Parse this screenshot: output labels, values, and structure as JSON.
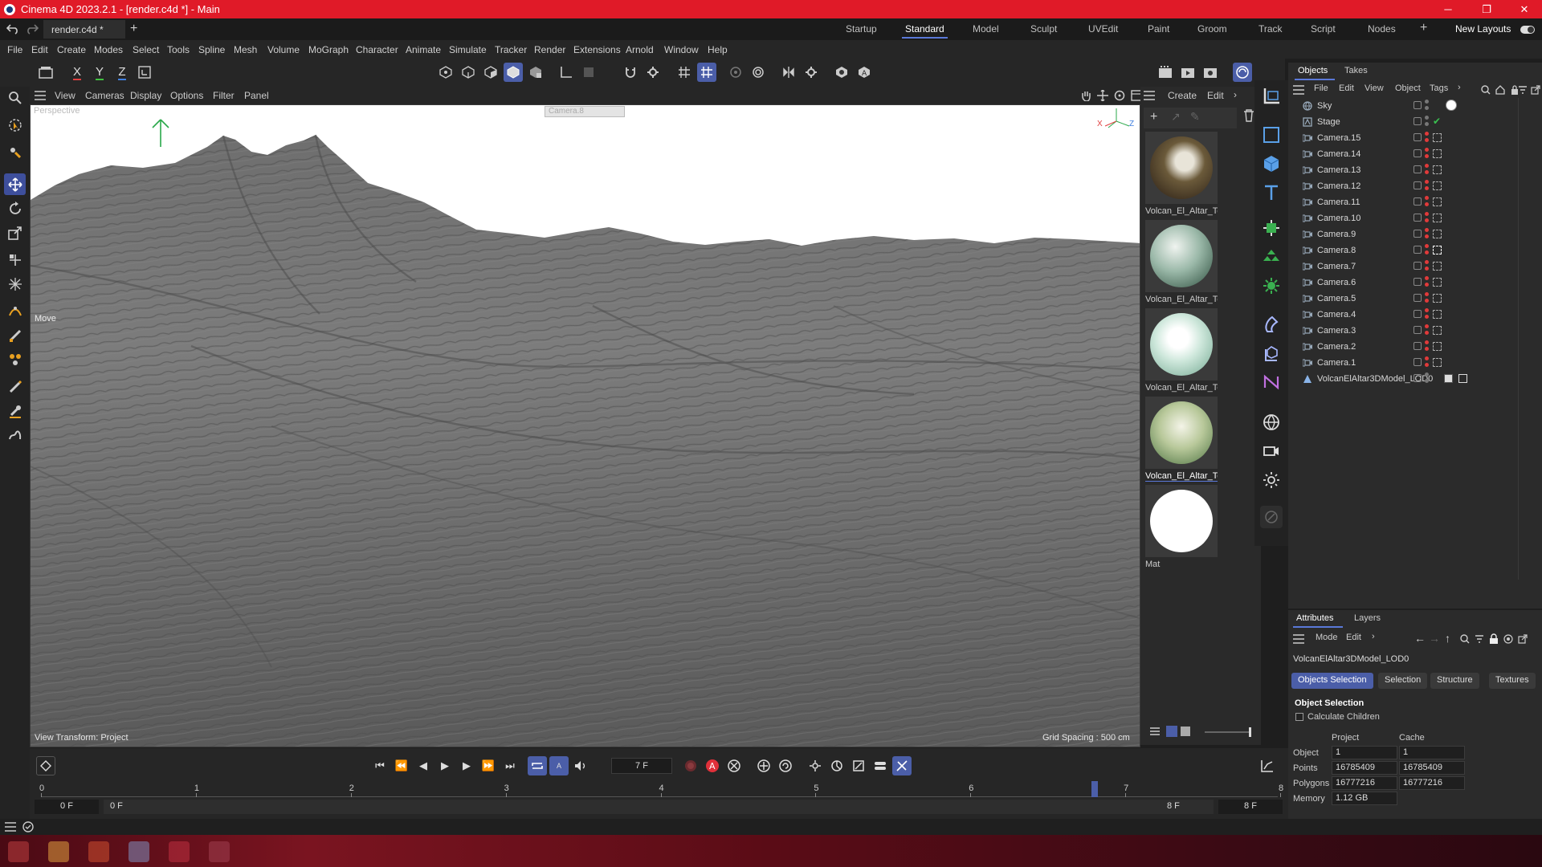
{
  "window": {
    "title": "Cinema 4D 2023.2.1 - [render.c4d *] - Main",
    "controls": [
      "─",
      "❐",
      "✕"
    ]
  },
  "tabs": {
    "document": "render.c4d *",
    "add": "+"
  },
  "layouts": {
    "items": [
      "Startup",
      "Standard",
      "Model",
      "Sculpt",
      "UVEdit",
      "Paint",
      "Groom",
      "Track",
      "Script",
      "Nodes"
    ],
    "active": "Standard",
    "add": "+",
    "new_layouts": "New Layouts"
  },
  "menu": [
    "File",
    "Edit",
    "Create",
    "Modes",
    "Select",
    "Tools",
    "Spline",
    "Mesh",
    "Volume",
    "MoGraph",
    "Character",
    "Animate",
    "Simulate",
    "Tracker",
    "Render",
    "Extensions",
    "Arnold",
    "Window",
    "Help"
  ],
  "toolbar": {
    "x": "X",
    "y": "Y",
    "z": "Z"
  },
  "viewport": {
    "menu": [
      "View",
      "Cameras",
      "Display",
      "Options",
      "Filter",
      "Panel"
    ],
    "label": "Perspective",
    "camera": "Camera.8",
    "tool": "Move",
    "view_transform": "View Transform: Project",
    "grid_spacing": "Grid Spacing : 500 cm",
    "axis_x": "X",
    "axis_z": "Z"
  },
  "materials": {
    "menu": [
      "Create",
      "Edit"
    ],
    "items": [
      {
        "name": "Volcan_El_Altar_Te"
      },
      {
        "name": "Volcan_El_Altar_Te"
      },
      {
        "name": "Volcan_El_Altar_Te"
      },
      {
        "name": "Volcan_El_Altar_Te"
      },
      {
        "name": "Mat"
      }
    ]
  },
  "objects": {
    "tabs": [
      "Objects",
      "Takes"
    ],
    "menu": [
      "File",
      "Edit",
      "View",
      "Object",
      "Tags"
    ],
    "items": [
      {
        "name": "Sky"
      },
      {
        "name": "Stage"
      },
      {
        "name": "Camera.15"
      },
      {
        "name": "Camera.14"
      },
      {
        "name": "Camera.13"
      },
      {
        "name": "Camera.12"
      },
      {
        "name": "Camera.11"
      },
      {
        "name": "Camera.10"
      },
      {
        "name": "Camera.9"
      },
      {
        "name": "Camera.8"
      },
      {
        "name": "Camera.7"
      },
      {
        "name": "Camera.6"
      },
      {
        "name": "Camera.5"
      },
      {
        "name": "Camera.4"
      },
      {
        "name": "Camera.3"
      },
      {
        "name": "Camera.2"
      },
      {
        "name": "Camera.1"
      },
      {
        "name": "VolcanElAltar3DModel_LOD0"
      }
    ]
  },
  "attributes": {
    "tabs": [
      "Attributes",
      "Layers"
    ],
    "menu": [
      "Mode",
      "Edit"
    ],
    "object_name": "VolcanElAltar3DModel_LOD0",
    "buttons": [
      "Objects Selection",
      "Selection",
      "Structure",
      "Textures"
    ],
    "section": "Object Selection",
    "calc_children": "Calculate Children",
    "col_project": "Project",
    "col_cache": "Cache",
    "rows": [
      {
        "label": "Object",
        "project": "1",
        "cache": "1"
      },
      {
        "label": "Points",
        "project": "16785409",
        "cache": "16785409"
      },
      {
        "label": "Polygons",
        "project": "16777216",
        "cache": "16777216"
      },
      {
        "label": "Memory",
        "project": "1.12 GB",
        "cache": ""
      }
    ]
  },
  "timeline": {
    "current_frame": "7 F",
    "ticks": [
      "0",
      "1",
      "2",
      "3",
      "4",
      "5",
      "6",
      "7",
      "8"
    ],
    "start": "0 F",
    "min": "0 F",
    "max": "8 F",
    "end": "8 F"
  },
  "colors": {
    "accent": "#4b5ea8",
    "title_bar": "#e01a28",
    "record": "#e0303a"
  }
}
